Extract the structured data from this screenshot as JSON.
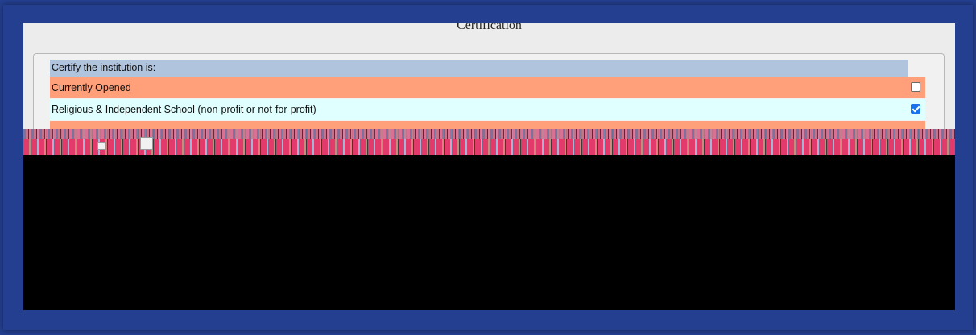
{
  "section": {
    "title": "Certification"
  },
  "certify": {
    "header": "Certify the institution is:",
    "options": [
      {
        "label": "Currently Opened",
        "checked": false
      },
      {
        "label": "Religious & Independent School (non-profit or not-for-profit)",
        "checked": true
      }
    ]
  },
  "colors": {
    "frame": "#243f8f",
    "header_row": "#b0c4de",
    "row_salmon": "#ffa07a",
    "row_cyan": "#e0ffff",
    "checkbox_checked": "#1a73e8"
  }
}
